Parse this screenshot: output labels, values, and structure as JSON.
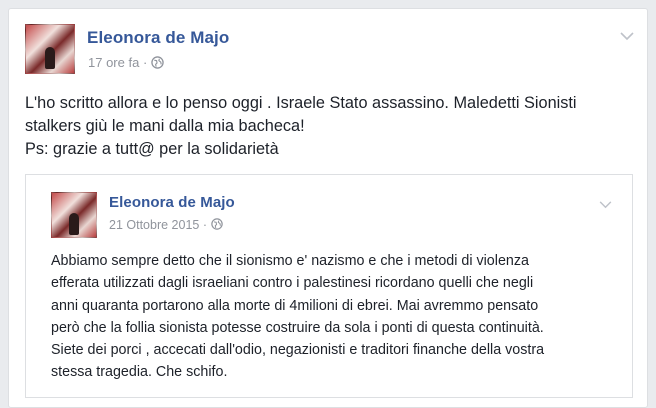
{
  "post": {
    "author": "Eleonora de Majo",
    "time": "17 ore fa",
    "separator": "·",
    "text_lines": [
      "L'ho scritto allora e lo penso oggi . Israele Stato assassino. Maledetti Sionisti",
      "stalkers giù le mani dalla mia bacheca!",
      "Ps: grazie a tutt@ per la solidarietà"
    ]
  },
  "shared_post": {
    "author": "Eleonora de Majo",
    "time": "21 Ottobre 2015",
    "separator": "·",
    "text_lines": [
      "Abbiamo sempre detto che il sionismo e' nazismo e che i metodi di violenza",
      "efferata utilizzati dagli israeliani contro i palestinesi ricordano quelli che negli",
      "anni quaranta portarono alla morte di 4milioni di ebrei. Mai avremmo pensato",
      "però che la follia sionista potesse costruire da sola i ponti di questa continuità.",
      "Siete dei porci , accecati dall'odio, negazionisti e traditori finanche della vostra",
      "stessa tragedia. Che schifo."
    ]
  },
  "colors": {
    "author": "#365899",
    "meta": "#90949c",
    "text": "#1d2129",
    "border": "#dddfe2",
    "background": "#e9ebee"
  },
  "icons": {
    "privacy": "globe-icon",
    "menu": "chevron-down-icon"
  }
}
